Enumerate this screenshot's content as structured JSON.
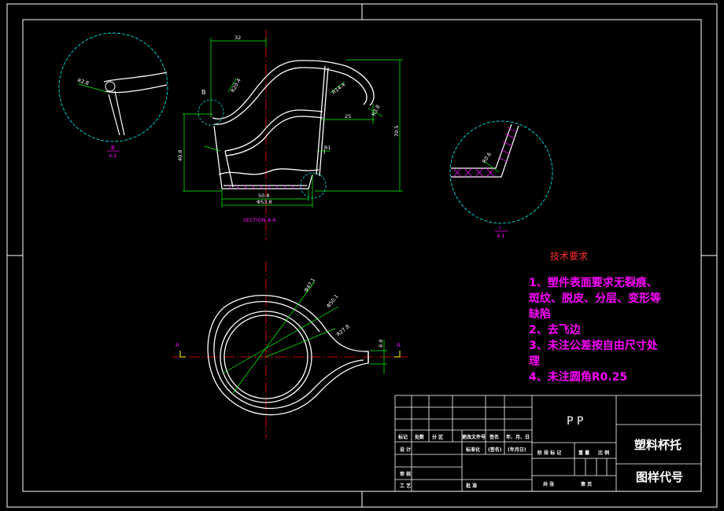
{
  "colors": {
    "background": "#000000",
    "outline": "#ffffff",
    "dimension": "#00ff00",
    "center_line": "#ff0000",
    "detail_circle": "#00ffff",
    "hatch": "#ff00ff",
    "note_text": "#ff00ff",
    "note_heading": "#ff3030",
    "section_label": "#ff00ff"
  },
  "section_view": {
    "dims": {
      "top_width": "32",
      "right_width": "25",
      "height_left": "40.8",
      "height_right": "70.5",
      "bottom_inner": "50.8",
      "bottom_outer": "Φ53.8",
      "r_small_a": "R20.4",
      "r_small_b": "R14.4",
      "r_small_c": "R3.8",
      "r_bottom": "R1"
    },
    "markers": {
      "detail_b": "B",
      "detail_i": "I"
    },
    "caption": "SECTION A-A"
  },
  "detail_b": {
    "radius_dim": "R2.8",
    "label": "B",
    "scale": "4:1"
  },
  "detail_i": {
    "radius_dim": "R0.6",
    "label": "I",
    "scale": "4:1"
  },
  "plan_view": {
    "dims": {
      "d1": "Φ47.1",
      "d2": "Φ50.1",
      "r_handle": "R27.8",
      "width_right": "8.8"
    },
    "cut_label_left": "A",
    "cut_label_right": "A"
  },
  "tech_requirements": {
    "heading": "技术要求",
    "items": [
      "1、塑件表面要求无裂痕、",
      "斑纹、脱皮、分层、变形等",
      "缺陷",
      "2、去飞边",
      "3、未注公差按自由尺寸处",
      "理",
      "4、未注圆角R0.25"
    ]
  },
  "title_block": {
    "material": "P P",
    "part_name": "塑料杯托",
    "drawing_code": "图样代号",
    "rev_headers": [
      "标记",
      "处数",
      "分  区",
      "更改文件号",
      "签名",
      "年、月、日"
    ],
    "design": "设  计",
    "standardize": "标准化",
    "signature": "(签名)",
    "date": "(年月日)",
    "review": "审  核",
    "process": "工  艺",
    "approve": "批  准",
    "stage_headers": [
      "阶  段  标  记",
      "重  量",
      "比  例"
    ],
    "sheets_total": "共     张",
    "sheet_no": "第     页"
  }
}
